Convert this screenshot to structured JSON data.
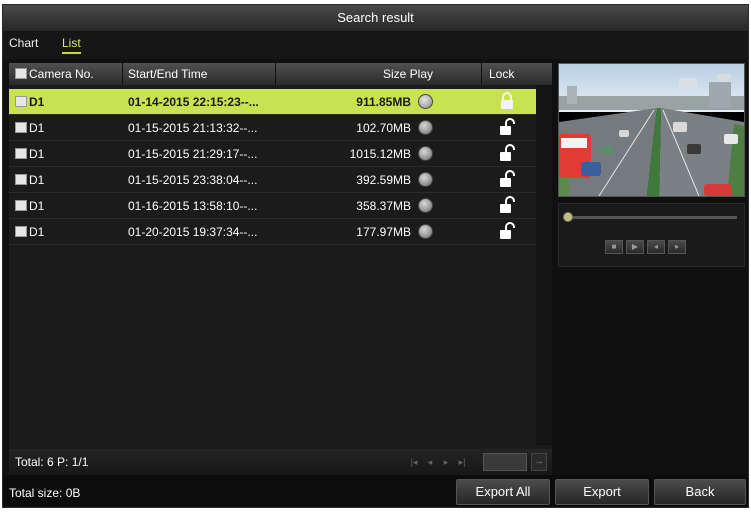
{
  "window": {
    "title": "Search result"
  },
  "tabs": [
    {
      "label": "Chart"
    },
    {
      "label": "List"
    }
  ],
  "table": {
    "headers": {
      "camera": "Camera No.",
      "time": "Start/End Time",
      "size_play": "Size Play",
      "lock": "Lock"
    },
    "rows": [
      {
        "camera": "D1",
        "time": "01-14-2015 22:15:23--...",
        "size": "911.85MB"
      },
      {
        "camera": "D1",
        "time": "01-15-2015 21:13:32--...",
        "size": "102.70MB"
      },
      {
        "camera": "D1",
        "time": "01-15-2015 21:29:17--...",
        "size": "1015.12MB"
      },
      {
        "camera": "D1",
        "time": "01-15-2015 23:38:04--...",
        "size": "392.59MB"
      },
      {
        "camera": "D1",
        "time": "01-16-2015 13:58:10--...",
        "size": "358.37MB"
      },
      {
        "camera": "D1",
        "time": "01-20-2015 19:37:34--...",
        "size": "177.97MB"
      }
    ]
  },
  "footer": {
    "total": "Total: 6  P: 1/1"
  },
  "bottom": {
    "total_size": "Total size: 0B",
    "export_all": "Export All",
    "export": "Export",
    "back": "Back"
  },
  "icons": {
    "play": "play-icon",
    "lock": "padlock-icon",
    "nav": "page-nav-arrows",
    "playback": "playback-controls"
  },
  "colors": {
    "selected_row": "#c9e24f",
    "active_tab": "#dcef62",
    "background": "#101010"
  }
}
